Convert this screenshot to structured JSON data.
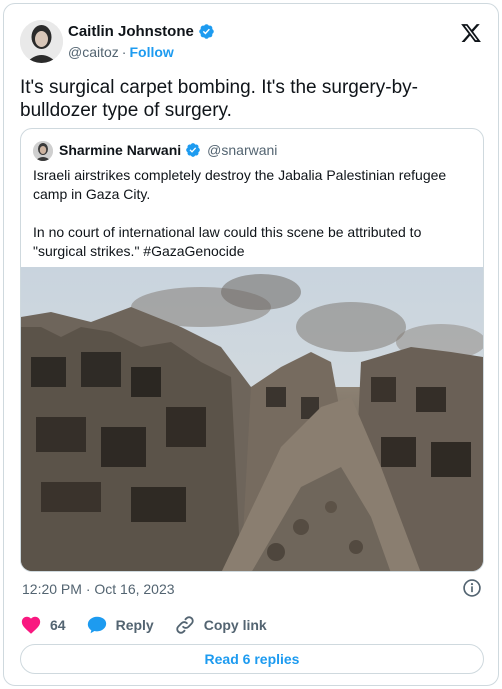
{
  "author": {
    "name": "Caitlin Johnstone",
    "handle": "@caitoz",
    "separator": "·",
    "follow_label": "Follow",
    "verified_icon": "verified-badge-icon"
  },
  "tweet": {
    "text": "It's surgical carpet bombing. It's the surgery-by-bulldozer type of surgery."
  },
  "quoted": {
    "name": "Sharmine Narwani",
    "handle": "@snarwani",
    "paragraph1": "Israeli airstrikes completely destroy the Jabalia Palestinian refugee camp in Gaza City.",
    "paragraph2": "In no court of international law could this scene be attributed to \"surgical strikes.\" #GazaGenocide"
  },
  "meta": {
    "timestamp": "12:20 PM · Oct 16, 2023"
  },
  "actions": {
    "like_count": "64",
    "reply_label": "Reply",
    "copy_label": "Copy link"
  },
  "read_replies_label": "Read 6 replies",
  "colors": {
    "accent": "#1d9bf0",
    "like": "#f91880",
    "secondary_text": "#536471",
    "border": "#cfd9de"
  }
}
